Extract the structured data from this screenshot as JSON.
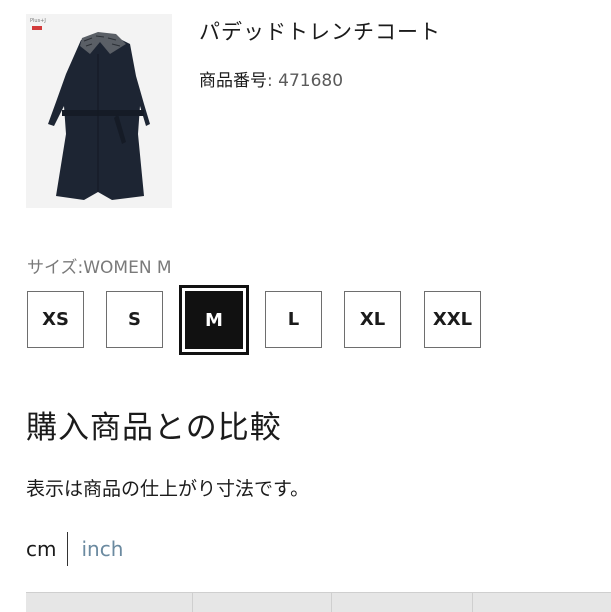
{
  "product": {
    "title": "パデッドトレンチコート",
    "code_label": "商品番号",
    "code_value": ": 471680",
    "image_icon": "coat-product-image"
  },
  "size": {
    "label": "サイズ:WOMEN M",
    "options": [
      "XS",
      "S",
      "M",
      "L",
      "XL",
      "XXL"
    ],
    "selected": "M"
  },
  "compare": {
    "heading": "購入商品との比較",
    "note": "表示は商品の仕上がり寸法です。"
  },
  "units": {
    "cm": "cm",
    "inch": "inch",
    "active": "cm",
    "inactive_color": "#6b8aa0"
  }
}
